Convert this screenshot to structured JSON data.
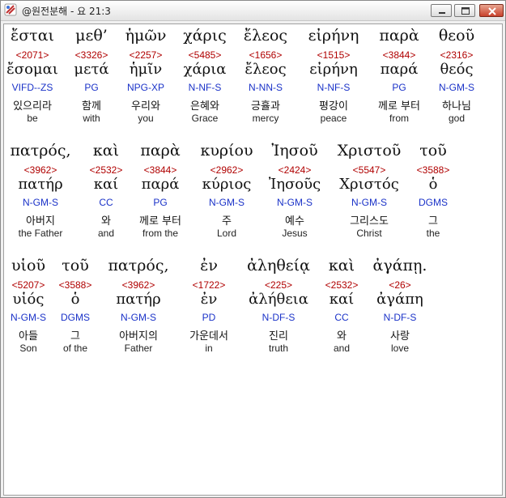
{
  "window": {
    "title": "@원전분해 - 요 21:3"
  },
  "verse": {
    "lines": [
      [
        {
          "greek": "ἔσται",
          "strong": "<2071>",
          "lemma": "ἔσομαι",
          "morph": "VIFD--ZS",
          "korean": "있으리라",
          "english": "be"
        },
        {
          "greek": "μεθ’",
          "strong": "<3326>",
          "lemma": "μετά",
          "morph": "PG",
          "korean": "함께",
          "english": "with"
        },
        {
          "greek": "ἡμῶν",
          "strong": "<2257>",
          "lemma": "ἡμῖν",
          "morph": "NPG-XP",
          "korean": "우리와",
          "english": "you"
        },
        {
          "greek": "χάρις",
          "strong": "<5485>",
          "lemma": "χάρια",
          "morph": "N-NF-S",
          "korean": "은혜와",
          "english": "Grace"
        },
        {
          "greek": "ἔλεος",
          "strong": "<1656>",
          "lemma": "ἔλεος",
          "morph": "N-NN-S",
          "korean": "긍휼과",
          "english": "mercy"
        },
        {
          "greek": "εἰρήνη",
          "strong": "<1515>",
          "lemma": "εἰρήνη",
          "morph": "N-NF-S",
          "korean": "평강이",
          "english": "peace"
        },
        {
          "greek": "παρὰ",
          "strong": "<3844>",
          "lemma": "παρά",
          "morph": "PG",
          "korean": "께로 부터",
          "english": "from"
        },
        {
          "greek": "θεοῦ",
          "strong": "<2316>",
          "lemma": "θεός",
          "morph": "N-GM-S",
          "korean": "하나님",
          "english": "god"
        }
      ],
      [
        {
          "greek": "πατρός,",
          "strong": "<3962>",
          "lemma": "πατήρ",
          "morph": "N-GM-S",
          "korean": "아버지",
          "english": "the Father"
        },
        {
          "greek": "καὶ",
          "strong": "<2532>",
          "lemma": "καί",
          "morph": "CC",
          "korean": "와",
          "english": "and"
        },
        {
          "greek": "παρὰ",
          "strong": "<3844>",
          "lemma": "παρά",
          "morph": "PG",
          "korean": "께로 부터",
          "english": "from the"
        },
        {
          "greek": "κυρίου",
          "strong": "<2962>",
          "lemma": "κύριος",
          "morph": "N-GM-S",
          "korean": "주",
          "english": "Lord"
        },
        {
          "greek": "Ἰησοῦ",
          "strong": "<2424>",
          "lemma": "Ἰησοῦς",
          "morph": "N-GM-S",
          "korean": "예수",
          "english": "Jesus"
        },
        {
          "greek": "Χριστοῦ",
          "strong": "<5547>",
          "lemma": "Χριστός",
          "morph": "N-GM-S",
          "korean": "그리스도",
          "english": "Christ"
        },
        {
          "greek": "τοῦ",
          "strong": "<3588>",
          "lemma": "ὁ",
          "morph": "DGMS",
          "korean": "그",
          "english": "the"
        }
      ],
      [
        {
          "greek": "υἱοῦ",
          "strong": "<5207>",
          "lemma": "υἱός",
          "morph": "N-GM-S",
          "korean": "아들",
          "english": "Son"
        },
        {
          "greek": "τοῦ",
          "strong": "<3588>",
          "lemma": "ὁ",
          "morph": "DGMS",
          "korean": "그",
          "english": "of the"
        },
        {
          "greek": "πατρός,",
          "strong": "<3962>",
          "lemma": "πατήρ",
          "morph": "N-GM-S",
          "korean": "아버지의",
          "english": "Father"
        },
        {
          "greek": "ἐν",
          "strong": "<1722>",
          "lemma": "ἐν",
          "morph": "PD",
          "korean": "가운데서",
          "english": "in"
        },
        {
          "greek": "ἀληθείᾳ",
          "strong": "<225>",
          "lemma": "ἀλήθεια",
          "morph": "N-DF-S",
          "korean": "진리",
          "english": "truth"
        },
        {
          "greek": "καὶ",
          "strong": "<2532>",
          "lemma": "καί",
          "morph": "CC",
          "korean": "와",
          "english": "and"
        },
        {
          "greek": "ἀγάπῃ.",
          "strong": "<26>",
          "lemma": "ἀγάπη",
          "morph": "N-DF-S",
          "korean": "사랑",
          "english": "love"
        }
      ]
    ]
  }
}
